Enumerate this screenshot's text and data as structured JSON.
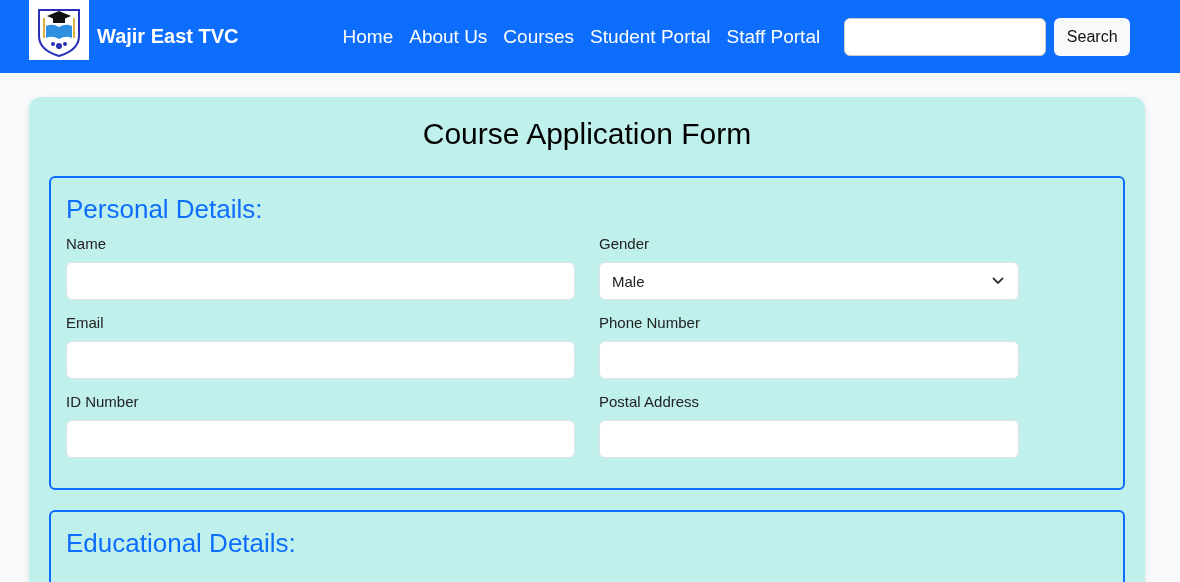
{
  "navbar": {
    "brand": "Wajir East TVC",
    "links": [
      "Home",
      "About Us",
      "Courses",
      "Student Portal",
      "Staff Portal"
    ],
    "search_button": "Search"
  },
  "form": {
    "title": "Course Application Form",
    "sections": [
      {
        "legend": "Personal Details:",
        "fields": [
          {
            "label": "Name",
            "kind": "text"
          },
          {
            "label": "Gender",
            "kind": "select",
            "value": "Male"
          },
          {
            "label": "Email",
            "kind": "text"
          },
          {
            "label": "Phone Number",
            "kind": "text"
          },
          {
            "label": "ID Number",
            "kind": "text"
          },
          {
            "label": "Postal Address",
            "kind": "text"
          }
        ]
      },
      {
        "legend": "Educational Details:"
      }
    ]
  }
}
